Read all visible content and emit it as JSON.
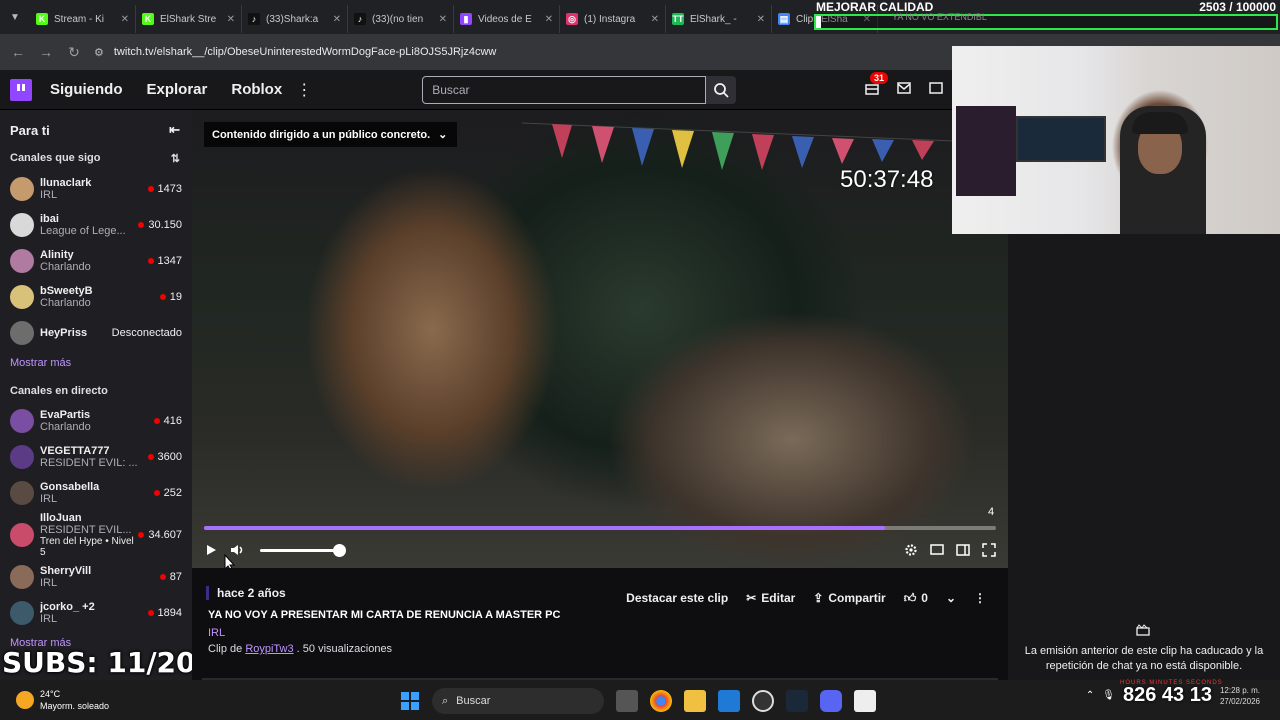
{
  "browser": {
    "tabs": [
      {
        "title": "Stream - Ki",
        "color": "#53fc18",
        "glyph": "K"
      },
      {
        "title": "ElShark Stre",
        "color": "#53fc18",
        "glyph": "K"
      },
      {
        "title": "(33)Shark:a",
        "color": "#111111",
        "glyph": "♪"
      },
      {
        "title": "(33)(no tien",
        "color": "#111111",
        "glyph": "♪"
      },
      {
        "title": "Videos de E",
        "color": "#9147ff",
        "glyph": "▮"
      },
      {
        "title": "(1) Instagra",
        "color": "#e1306c",
        "glyph": "◎"
      },
      {
        "title": "ElShark_ - ",
        "color": "#1db954",
        "glyph": "TT"
      },
      {
        "title": "Clips ElSha",
        "color": "#4285f4",
        "glyph": "▤"
      }
    ],
    "url": "twitch.tv/elshark__/clip/ObeseUninterestedWormDogFace-pLi8OJS5JRjz4cww"
  },
  "overlay": {
    "quality_label": "MEJORAR CALIDAD",
    "counter": "2503 / 100000",
    "overlay_tabs": "YA NO VO      EXTENDIBL",
    "subs": "SUBS: 11/20",
    "big_numbers": "826 43 13"
  },
  "twitch_nav": {
    "links": [
      "Siguiendo",
      "Explorar",
      "Roblox"
    ],
    "search_placeholder": "Buscar",
    "notif_count": "31"
  },
  "sidebar": {
    "title": "Para ti",
    "followed_header": "Canales que sigo",
    "followed": [
      {
        "name": "llunaclark",
        "category": "IRL",
        "viewers": "1473",
        "color": "#c59b6d"
      },
      {
        "name": "ibai",
        "category": "League of Lege...",
        "viewers": "30.150",
        "color": "#d9d9d9"
      },
      {
        "name": "Alinity",
        "category": "Charlando",
        "viewers": "1347",
        "color": "#b07aa1"
      },
      {
        "name": "bSweetyB",
        "category": "Charlando",
        "viewers": "19",
        "color": "#d8c27a"
      },
      {
        "name": "HeyPriss",
        "category": "",
        "viewers": "Desconectado",
        "color": "#6d6d6d"
      }
    ],
    "show_more": "Mostrar más",
    "live_header": "Canales en directo",
    "live": [
      {
        "name": "EvaPartis",
        "category": "Charlando",
        "viewers": "416",
        "color": "#7a4ea3"
      },
      {
        "name": "VEGETTA777",
        "category": "RESIDENT EVIL: ...",
        "viewers": "3600",
        "color": "#5b3b86"
      },
      {
        "name": "Gonsabella",
        "category": "IRL",
        "viewers": "252",
        "color": "#5a4b42"
      },
      {
        "name": "IlloJuan",
        "category": "RESIDENT EVIL...",
        "viewers": "34.607",
        "color": "#c94c6b",
        "extra": "Tren del Hype • Nivel 5"
      },
      {
        "name": "SherryVill",
        "category": "IRL",
        "viewers": "87",
        "color": "#8a6b5a"
      },
      {
        "name": "jcorko_ +2",
        "category": "IRL",
        "viewers": "1894",
        "color": "#3d5a6b"
      }
    ],
    "show_more_2": "Mostrar más"
  },
  "video": {
    "content_warning": "Contenido dirigido a un público concreto.",
    "timer": "50:37:48",
    "corner_number": "4",
    "progress": 0.86,
    "volume": 1.0
  },
  "clip": {
    "ago": "hace 2 años",
    "title": "YA NO VOY A PRESENTAR MI CARTA DE RENUNCIA A MASTER PC",
    "category": "IRL",
    "clip_by": "Clip de",
    "author": "RoypiTw3",
    "views": ". 50 visualizaciones",
    "highlight_btn": "Destacar este clip",
    "edit_btn": "Editar",
    "share_btn": "Compartir",
    "likes": "0"
  },
  "chat": {
    "message": "La emisión anterior de este clip ha caducado y la repetición de chat ya no está disponible."
  },
  "taskbar": {
    "temp": "24°C",
    "weather": "Mayorm. soleado",
    "search": "Buscar",
    "time": "12:28 p. m.",
    "date": "27/02/2026",
    "tiny_labels": "HOURS   MINUTES   SECONDS"
  }
}
